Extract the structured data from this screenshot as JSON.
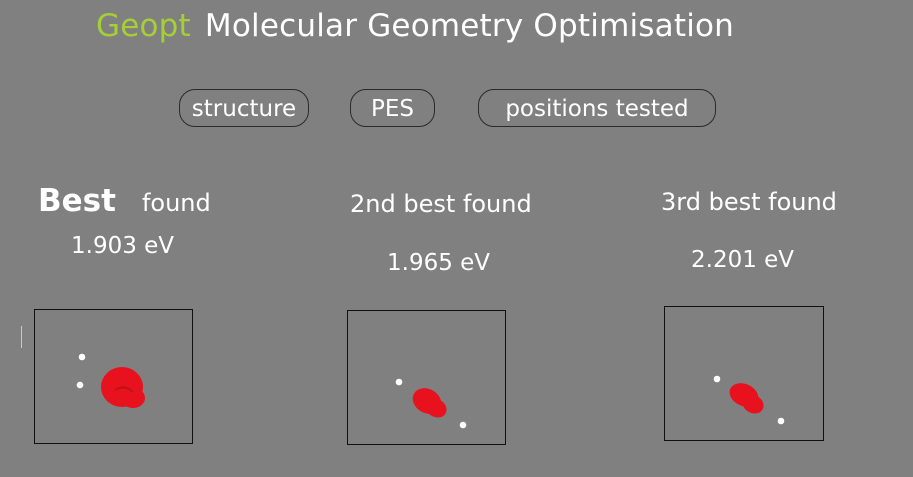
{
  "header": {
    "brand": "Geopt",
    "title": "Molecular Geometry Optimisation"
  },
  "tabs": [
    "structure",
    "PES",
    "positions tested"
  ],
  "results": [
    {
      "heading_main": "Best",
      "heading_rest": "found",
      "energy": "1.903 eV"
    },
    {
      "heading": "2nd best found",
      "energy": "1.965 eV"
    },
    {
      "heading": "3rd best found",
      "energy": "2.201 eV"
    }
  ],
  "colors": {
    "background": "#808080",
    "brand": "#a4cf35",
    "atom_cluster": "#e8121e",
    "point": "#ffffff"
  }
}
